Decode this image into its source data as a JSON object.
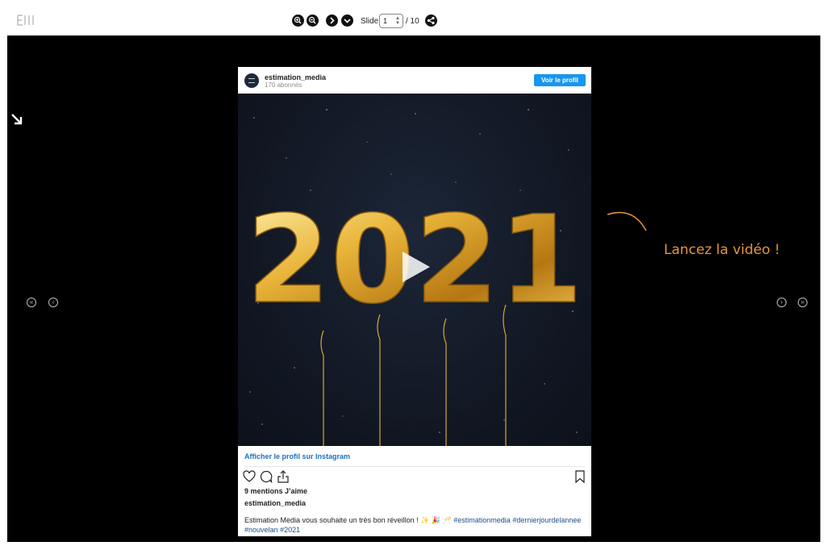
{
  "toolbar": {
    "logo_icon": "em-logo-icon",
    "buttons": [
      "zoom-in-icon",
      "zoom-out-icon",
      "next-icon",
      "menu-down-icon",
      "share-icon"
    ],
    "slide_label": "Slide:",
    "slide_value": "1",
    "slide_total": "/ 10"
  },
  "stage": {
    "corner_icon": "expand-arrow-icon",
    "hint_text": "Lancez la vidéo !",
    "hint_color": "#e5963a",
    "nav_first": "«",
    "nav_prev": "‹",
    "nav_next": "›",
    "nav_last": "»"
  },
  "post": {
    "username": "estimation_media",
    "followers": "170 abonnés",
    "follow_button": "Voir le profil",
    "media_text": "2021",
    "ig_link": "Afficher le profil sur Instagram",
    "likes": "9 mentions J’aime",
    "caption_user": "estimation_media",
    "caption_text": "Estimation Media vous souhaite un très bon réveillon ! ✨ 🎉 🥂",
    "hashtags": [
      "#estimationmedia",
      "#dernierjourdelannee",
      "#nouvelan",
      "#2021"
    ],
    "accent_blue": "#1896f0"
  }
}
